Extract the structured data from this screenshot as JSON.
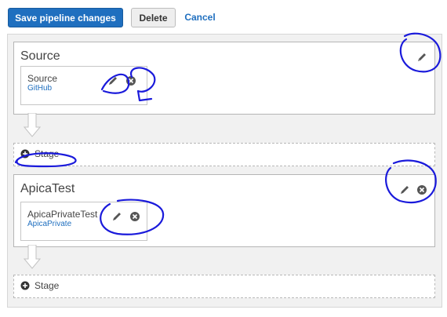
{
  "toolbar": {
    "save_label": "Save pipeline changes",
    "delete_label": "Delete",
    "cancel_label": "Cancel"
  },
  "stages": [
    {
      "name": "Source",
      "actions": [
        {
          "name": "Source",
          "provider": "GitHub"
        }
      ]
    },
    {
      "name": "ApicaTest",
      "actions": [
        {
          "name": "ApicaPrivateTest",
          "provider": "ApicaPrivate"
        }
      ]
    }
  ],
  "add_stage_label": "Stage",
  "icons": {
    "edit": "pencil-icon",
    "remove": "close-circle-icon",
    "add": "plus-circle-icon",
    "transition": "down-arrow-icon"
  },
  "colors": {
    "primary": "#1f6fbf",
    "link": "#1f6fbf",
    "annotation": "#1a1adb",
    "icon": "#555555"
  }
}
